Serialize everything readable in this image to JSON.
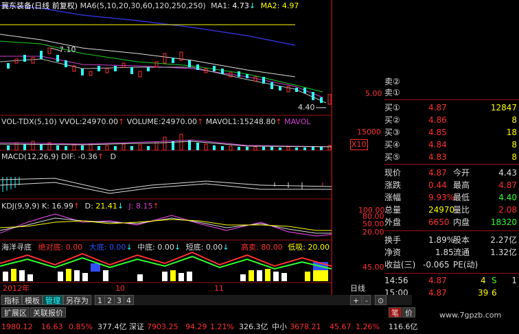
{
  "header": {
    "stock_title": "冀东装备(日线 前复权)",
    "ma_label": "MA6(5,10,20,30,60,120,250,250)",
    "ma1_label": "MA1:",
    "ma1_value": "4.73",
    "ma2_label": "MA2:",
    "ma2_value": "4.97"
  },
  "price_panel": {
    "high_marker": "7.10",
    "low_marker": "4.40",
    "axis_label_5": "5.00"
  },
  "volume_panel": {
    "name": "VOL-TDX(5,10)",
    "vvol_label": "VVOL:",
    "vvol_value": "24970.00",
    "volume_label": "VOLUME:",
    "volume_value": "24970.00",
    "mavol1_label": "MAVOL1:",
    "mavol1_value": "15248.80",
    "mavol_label": "MAVOL",
    "axis_15000": "15000",
    "unit": "X10"
  },
  "macd_panel": {
    "name": "MACD(12,26,9)",
    "dif_label": "DIF:",
    "dif_value": "-0.36",
    "d_label": "D"
  },
  "kdj_panel": {
    "name": "KDJ(9,9,9)",
    "k_label": "K:",
    "k_value": "16.99",
    "d_label": "D:",
    "d_value": "21.41",
    "j_label": "J:",
    "j_value": "8.15",
    "axis": [
      "100.00",
      "80.00",
      "50.00",
      "20.00"
    ]
  },
  "haiyang_panel": {
    "name": "海洋寻底",
    "items": [
      {
        "label": "绝对底:",
        "value": "0.00",
        "color": "#ff3030"
      },
      {
        "label": "大底:",
        "value": "0.00",
        "color": "#3050ff"
      },
      {
        "label": "中底:",
        "value": "0.00",
        "color": "#dddddd"
      },
      {
        "label": "短底:",
        "value": "0.00",
        "color": "#dddddd"
      },
      {
        "label": "高卖:",
        "value": "80.00",
        "color": "#ff3030"
      },
      {
        "label": "低吸:",
        "value": "20.00",
        "color": "#ffff00"
      }
    ],
    "axis_45": "45.00"
  },
  "time_axis": {
    "year": "2012年",
    "month_10": "10",
    "month_11": "11",
    "period": "日线"
  },
  "order_book": {
    "sell_rows": [
      {
        "label": "卖②"
      },
      {
        "label": "卖①"
      }
    ],
    "buy_rows": [
      {
        "label": "买①",
        "price": "4.87",
        "vol": "12847"
      },
      {
        "label": "买②",
        "price": "4.86",
        "vol": "8"
      },
      {
        "label": "买③",
        "price": "4.85",
        "vol": "18"
      },
      {
        "label": "买④",
        "price": "4.84",
        "vol": "8"
      },
      {
        "label": "买⑤",
        "price": "4.83",
        "vol": "8"
      }
    ]
  },
  "quote": {
    "rows": [
      {
        "l1": "现价",
        "v1": "4.87",
        "c1": "#ff3030",
        "l2": "今开",
        "v2": "4.43",
        "c2": "#dddddd"
      },
      {
        "l1": "涨跌",
        "v1": "0.44",
        "c1": "#ff3030",
        "l2": "最高",
        "v2": "4.87",
        "c2": "#ff3030"
      },
      {
        "l1": "涨幅",
        "v1": "9.93%",
        "c1": "#ff3030",
        "l2": "最低",
        "v2": "4.40",
        "c2": "#30ff30"
      },
      {
        "l1": "总量",
        "v1": "24970",
        "c1": "#ffff00",
        "l2": "量比",
        "v2": "2.08",
        "c2": "#ff3030"
      },
      {
        "l1": "外盘",
        "v1": "6650",
        "c1": "#ff3030",
        "l2": "内盘",
        "v2": "18320",
        "c2": "#30ff30"
      }
    ],
    "rows2": [
      {
        "l1": "换手",
        "v1": "1.89%",
        "l2": "股本",
        "v2": "2.27亿"
      },
      {
        "l1": "净资",
        "v1": "1.85",
        "l2": "流通",
        "v2": "1.32亿"
      },
      {
        "l1": "收益(三)",
        "v1": "-0.065",
        "l2": "PE(动)",
        "v2": ""
      }
    ]
  },
  "ticks": [
    {
      "time": "14:56",
      "price": "4.87",
      "vol": "4",
      "flag": "S",
      "num": "1"
    },
    {
      "time": "15:00",
      "price": "4.87",
      "vol": "39",
      "flag": "6",
      "num": ""
    }
  ],
  "tabs": {
    "t1": "指标",
    "t2": "模板",
    "t3": "管理",
    "t4": "另存为",
    "n1": "1",
    "n2": "2",
    "n3": "3",
    "n4": "4",
    "ext": "扩展区",
    "rel": "关联报价",
    "plus": "+",
    "minus": "-",
    "bi": "笔",
    "jia": "价"
  },
  "status_bar": {
    "sh_val": "1980.12",
    "sh_chg": "16.63",
    "sh_pct": "0.85%",
    "sh_amt": "377.4亿",
    "sz_name": "深证",
    "sz_val": "7903.25",
    "sz_chg": "94.29",
    "sz_pct": "1.21%",
    "sz_amt": "326.3亿",
    "zx_name": "中小",
    "zx_val": "3678.21",
    "zx_chg": "45.67",
    "zx_pct": "1.26%",
    "zx_amt": "116.6亿",
    "watermark": "www.7gpzb.com"
  },
  "colors": {
    "up": "#ff3030",
    "down": "#30ffff",
    "grid": "#a01010",
    "ma_blue": "#3030d0",
    "ma_yellow": "#ffff00"
  }
}
